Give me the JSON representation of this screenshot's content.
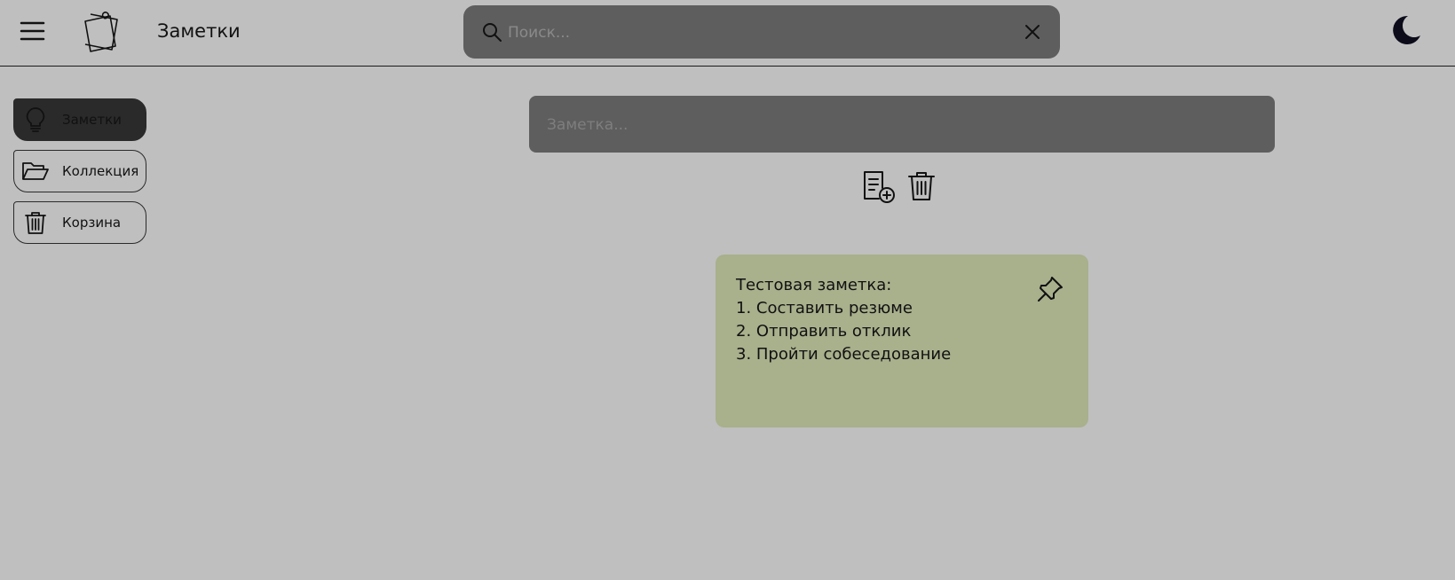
{
  "header": {
    "menu_icon": "hamburger-menu-icon",
    "logo_icon": "sticky-notes-logo-icon",
    "app_title": "Заметки",
    "search": {
      "placeholder": "Поиск...",
      "value": "",
      "search_icon": "search-icon",
      "clear_icon": "close-icon"
    },
    "theme_icon": "moon-icon"
  },
  "sidebar": {
    "items": [
      {
        "label": "Заметки",
        "icon": "lightbulb-icon",
        "active": true
      },
      {
        "label": "Коллекция",
        "icon": "folder-open-icon",
        "active": false
      },
      {
        "label": "Корзина",
        "icon": "trash-icon",
        "active": false
      }
    ]
  },
  "main": {
    "note_input": {
      "placeholder": "Заметка...",
      "value": ""
    },
    "actions": {
      "add_icon": "add-note-icon",
      "delete_icon": "trash-icon"
    },
    "notes": [
      {
        "lines": [
          "Тестовая заметка:",
          "1. Составить резюме",
          "2. Отправить отклик",
          "3. Пройти собеседование"
        ],
        "pin_icon": "pin-icon"
      }
    ]
  },
  "colors": {
    "background": "#bfbfbf",
    "surface_dark": "#5e5e5e",
    "active_item": "#2a2a2a",
    "note_card": "#a8b08c",
    "icon": "#111111"
  }
}
